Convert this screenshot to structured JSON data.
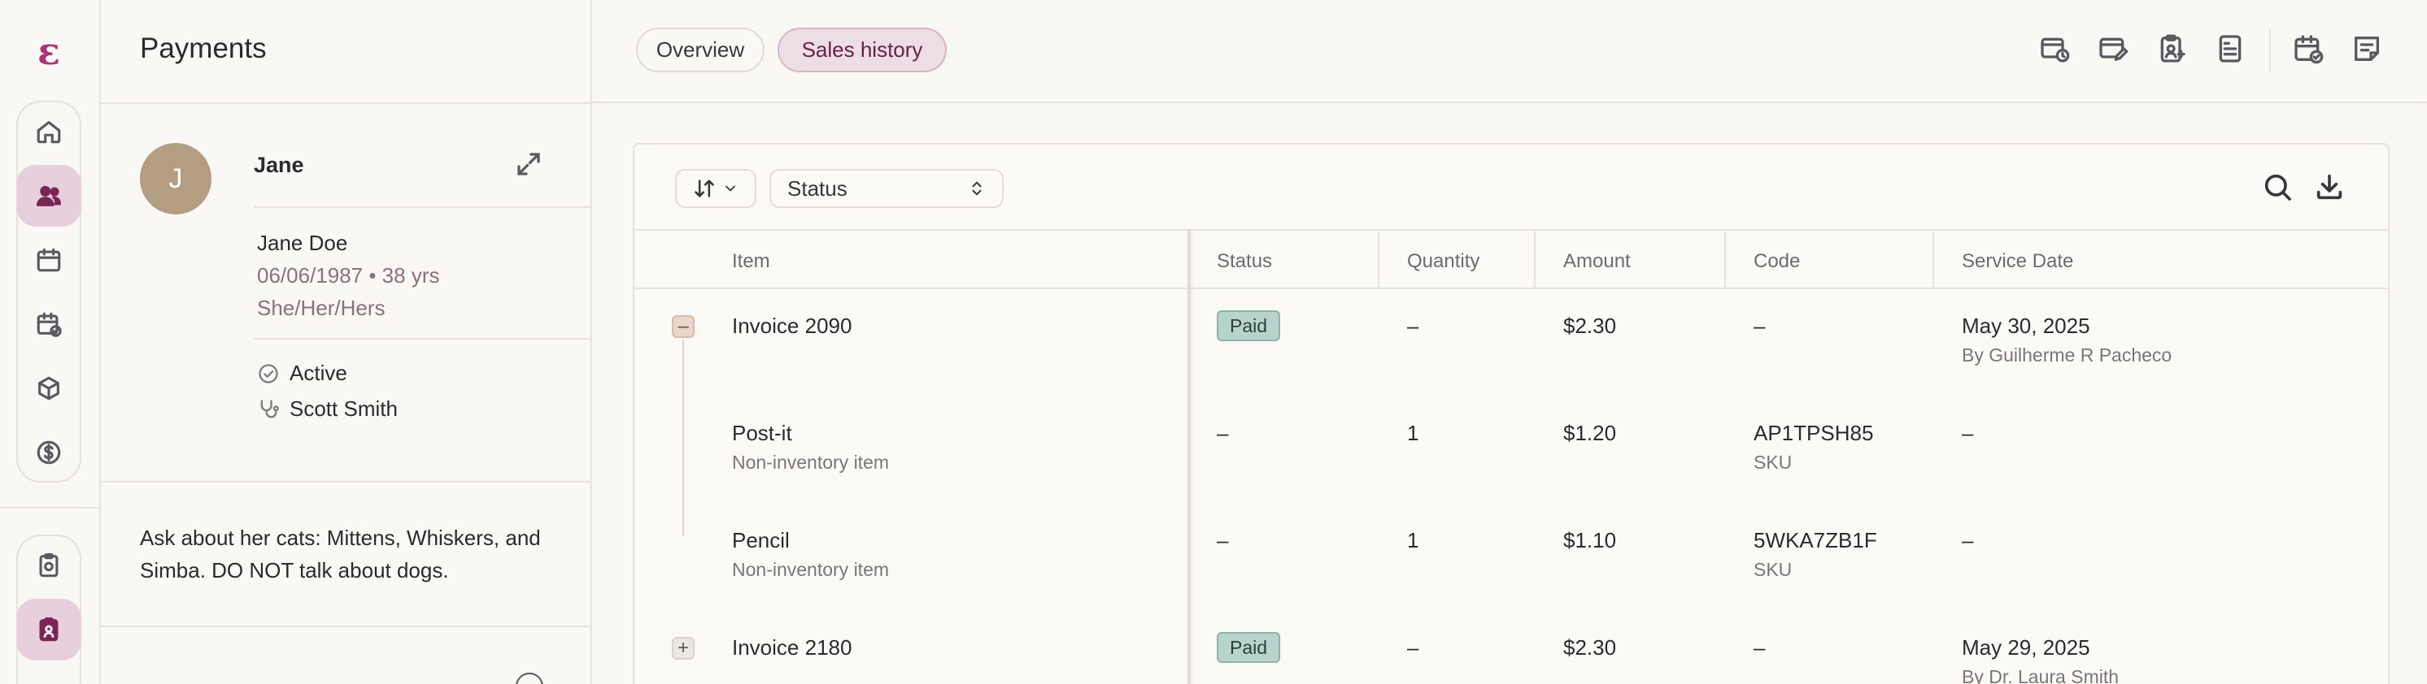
{
  "rail": {
    "logo": "ɛ",
    "items": [
      {
        "name": "home",
        "icon": "home-icon",
        "active": false
      },
      {
        "name": "patients",
        "icon": "users-icon",
        "active": true
      },
      {
        "name": "calendar",
        "icon": "calendar-icon",
        "active": false
      },
      {
        "name": "schedule",
        "icon": "calendar-check-icon",
        "active": false
      },
      {
        "name": "inventory",
        "icon": "box-icon",
        "active": false
      },
      {
        "name": "payments",
        "icon": "dollar-icon",
        "active": false
      },
      {
        "name": "clipboard",
        "icon": "clipboard-icon",
        "active": false
      },
      {
        "name": "badge",
        "icon": "id-badge-icon",
        "active": true
      }
    ]
  },
  "panel": {
    "title": "Payments",
    "patient": {
      "initial": "J",
      "name": "Jane",
      "full_name": "Jane Doe",
      "dob": "06/06/1987 • 38 yrs",
      "pronouns": "She/Her/Hers",
      "status": "Active",
      "provider": "Scott Smith"
    },
    "note": "Ask about her cats: Mittens, Whiskers, and Simba. DO NOT talk about dogs."
  },
  "tabs": [
    {
      "label": "Overview",
      "active": false
    },
    {
      "label": "Sales history",
      "active": true
    }
  ],
  "toolbar_icons": [
    "billing-clock-icon",
    "card-edit-icon",
    "clipboard-user-icon",
    "document-lines-icon",
    "calendar-check-icon",
    "sticky-note-icon"
  ],
  "table": {
    "sort_label": "",
    "status_filter": "Status",
    "columns": [
      "Item",
      "Status",
      "Quantity",
      "Amount",
      "Code",
      "Service Date"
    ],
    "rows": [
      {
        "item": "Invoice 2090",
        "item_sub": "",
        "status": "Paid",
        "quantity": "–",
        "amount": "$2.30",
        "code": "–",
        "code_sub": "",
        "date": "May 30, 2025",
        "date_sub": "By Guilherme R Pacheco",
        "toggle": "–"
      },
      {
        "item": "Post-it",
        "item_sub": "Non-inventory item",
        "status": "–",
        "quantity": "1",
        "amount": "$1.20",
        "code": "AP1TPSH85",
        "code_sub": "SKU",
        "date": "–",
        "date_sub": ""
      },
      {
        "item": "Pencil",
        "item_sub": "Non-inventory item",
        "status": "–",
        "quantity": "1",
        "amount": "$1.10",
        "code": "5WKA7ZB1F",
        "code_sub": "SKU",
        "date": "–",
        "date_sub": ""
      },
      {
        "item": "Invoice 2180",
        "item_sub": "",
        "status": "Paid",
        "quantity": "–",
        "amount": "$2.30",
        "code": "–",
        "code_sub": "",
        "date": "May 29, 2025",
        "date_sub": "By Dr. Laura Smith",
        "toggle": "+"
      }
    ]
  },
  "colors": {
    "accent": "#b0307a",
    "active_bg": "#e8cfdc",
    "paid_badge": "#b7d4cc",
    "avatar": "#b39e82"
  }
}
